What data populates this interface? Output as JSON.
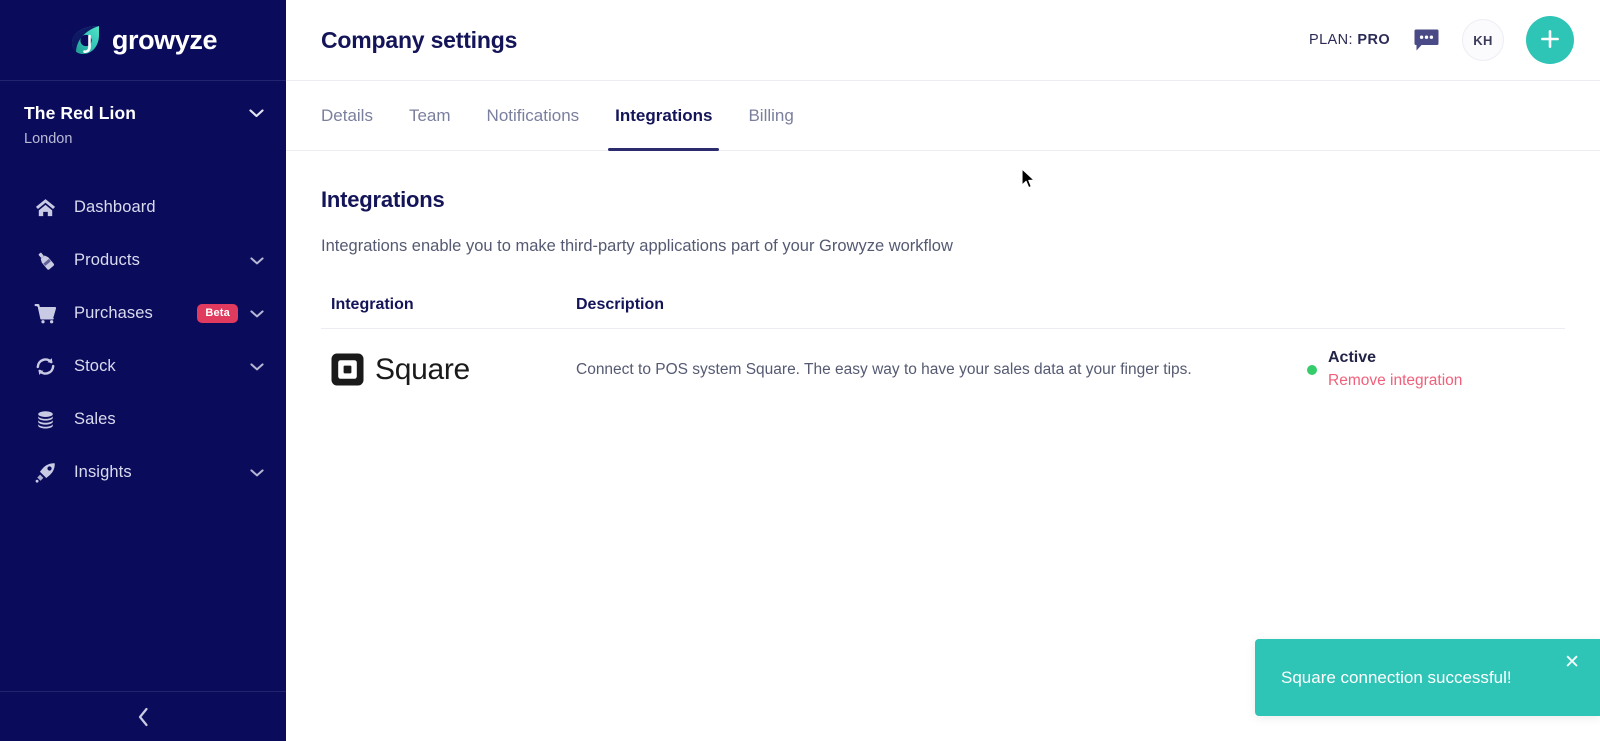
{
  "sidebar": {
    "brand": {
      "name": "growyze",
      "logo_icon": "growyze-leaf-logo"
    },
    "org": {
      "name": "The Red Lion",
      "location": "London",
      "chevron_icon": "chevron-down-icon"
    },
    "items": [
      {
        "label": "Dashboard",
        "icon": "home-icon",
        "badge": null,
        "chevron": false
      },
      {
        "label": "Products",
        "icon": "bottle-icon",
        "badge": null,
        "chevron": true
      },
      {
        "label": "Purchases",
        "icon": "shopping-cart-icon",
        "badge": "Beta",
        "chevron": true
      },
      {
        "label": "Stock",
        "icon": "sync-refresh-icon",
        "badge": null,
        "chevron": true
      },
      {
        "label": "Sales",
        "icon": "coins-stack-icon",
        "badge": null,
        "chevron": false
      },
      {
        "label": "Insights",
        "icon": "rocket-icon",
        "badge": null,
        "chevron": true
      }
    ],
    "collapse_icon": "chevron-left-icon"
  },
  "header": {
    "title": "Company settings",
    "plan_prefix": "PLAN:",
    "plan_value": "PRO",
    "chat_icon": "chat-bubble-icon",
    "avatar_initials": "KH",
    "add_icon": "plus-icon"
  },
  "tabs": [
    {
      "label": "Details",
      "active": false
    },
    {
      "label": "Team",
      "active": false
    },
    {
      "label": "Notifications",
      "active": false
    },
    {
      "label": "Integrations",
      "active": true
    },
    {
      "label": "Billing",
      "active": false
    }
  ],
  "content": {
    "heading": "Integrations",
    "description": "Integrations enable you to make third-party applications part of your Growyze workflow",
    "table": {
      "columns": [
        "Integration",
        "Description"
      ],
      "rows": [
        {
          "integration_name": "Square",
          "integration_icon": "square-logo-icon",
          "description": "Connect to POS system Square. The easy way to have your sales data at your finger tips.",
          "status": "Active",
          "status_dot_color": "#35cc6c",
          "action_label": "Remove integration"
        }
      ]
    }
  },
  "toast": {
    "message": "Square connection successful!",
    "close_icon": "close-icon",
    "background_color": "#2ec4b6"
  },
  "colors": {
    "sidebar_bg": "#0b0b5c",
    "accent_teal": "#2ec4b6",
    "badge_pink": "#e03a5f",
    "danger_pink": "#f0607a",
    "heading_navy": "#141459"
  }
}
